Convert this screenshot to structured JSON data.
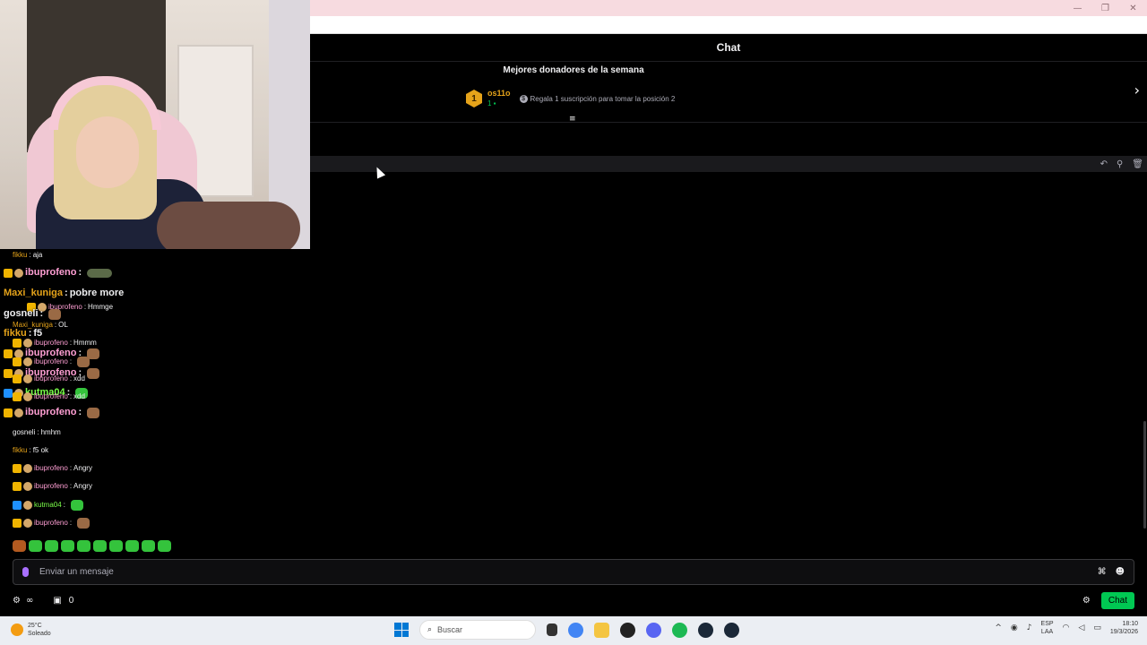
{
  "window": {
    "minimize": "—",
    "restore": "❐",
    "close": "✕"
  },
  "chat": {
    "title": "Chat",
    "donors_title": "Mejores donadores de la semana",
    "top_donor": {
      "rank": "1",
      "name": "os11o",
      "count": "1"
    },
    "gift_note": "Regala 1 suscripción para tomar la posición 2"
  },
  "overlay_messages": [
    {
      "user": "fikku",
      "text": "aja",
      "style": "small",
      "color": "orange"
    },
    {
      "user": "ibuprofeno",
      "text": "",
      "style": "big",
      "color": "pink"
    },
    {
      "user": "Maxi_kuniga",
      "text": "pobre more",
      "style": "big",
      "color": "orange"
    },
    {
      "user": "ibuprofeno",
      "text": "Hmmge",
      "style": "small",
      "color": "pink"
    },
    {
      "user": "gosneli",
      "text": "",
      "style": "big",
      "color": "white"
    },
    {
      "user": "Maxi_kuniga",
      "text": "OL",
      "style": "small",
      "color": "orange"
    },
    {
      "user": "fikku",
      "text": "f5",
      "style": "big",
      "color": "orange"
    },
    {
      "user": "ibuprofeno",
      "text": "Hmmm",
      "style": "small",
      "color": "pink"
    },
    {
      "user": "ibuprofeno",
      "text": "",
      "style": "big",
      "color": "pink"
    },
    {
      "user": "ibuprofeno",
      "text": "",
      "style": "small",
      "color": "pink"
    },
    {
      "user": "ibuprofeno",
      "text": "",
      "style": "big",
      "color": "pink"
    },
    {
      "user": "ibuprofeno",
      "text": "xdd",
      "style": "small",
      "color": "pink"
    },
    {
      "user": "kutma04",
      "text": "",
      "style": "big",
      "color": "green"
    },
    {
      "user": "ibuprofeno",
      "text": "xdd",
      "style": "small",
      "color": "pink"
    },
    {
      "user": "ibuprofeno",
      "text": "",
      "style": "big",
      "color": "pink"
    },
    {
      "user": "gosneli",
      "text": "hmhm",
      "style": "small",
      "color": "white"
    },
    {
      "user": "fikku",
      "text": "f5 ok",
      "style": "small",
      "color": "orange"
    },
    {
      "user": "ibuprofeno",
      "text": "Angry",
      "style": "small",
      "color": "pink"
    },
    {
      "user": "ibuprofeno",
      "text": "Angry",
      "style": "small",
      "color": "pink"
    },
    {
      "user": "kutma04",
      "text": "",
      "style": "small",
      "color": "green"
    },
    {
      "user": "ibuprofeno",
      "text": "",
      "style": "small",
      "color": "pink"
    }
  ],
  "input": {
    "placeholder": "Enviar un mensaje"
  },
  "bottom": {
    "points_count": "0",
    "chat_button": "Chat"
  },
  "taskbar": {
    "temp": "25°C",
    "weather": "Soleado",
    "search": "Buscar",
    "lang1": "ESP",
    "lang2": "LAA",
    "time": "18:10",
    "date": "19/3/2026"
  },
  "colors": {
    "accent": "#00c853",
    "gold": "#e5a31a",
    "purple": "#a970ff"
  }
}
